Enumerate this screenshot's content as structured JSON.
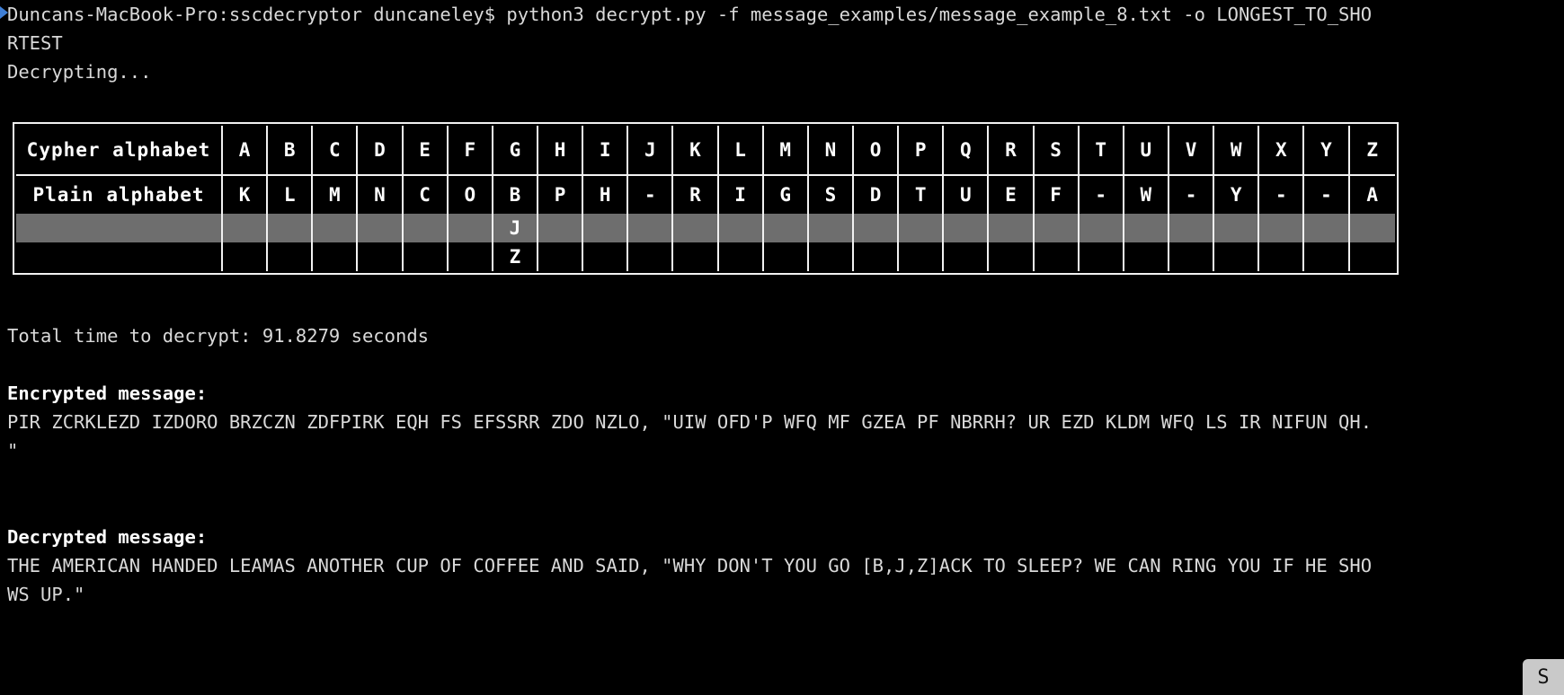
{
  "terminal": {
    "prompt_line_1": "Duncans-MacBook-Pro:sscdecryptor duncaneley$ python3 decrypt.py -f message_examples/message_example_8.txt -o LONGEST_TO_SHO",
    "prompt_line_2": "RTEST",
    "status_line": "Decrypting...",
    "total_time_line": "Total time to decrypt: 91.8279 seconds",
    "encrypted_heading": "Encrypted message:",
    "encrypted_line_1": "PIR ZCRKLEZD IZDORO BRZCZN ZDFPIRK EQH FS EFSSRR ZDO NZLO, \"UIW OFD'P WFQ MF GZEA PF NBRRH? UR EZD KLDM WFQ LS IR NIFUN QH.",
    "encrypted_line_2": "\"",
    "decrypted_heading": "Decrypted message:",
    "decrypted_line_1": "THE AMERICAN HANDED LEAMAS ANOTHER CUP OF COFFEE AND SAID, \"WHY DON'T YOU GO [B,J,Z]ACK TO SLEEP? WE CAN RING YOU IF HE SHO",
    "decrypted_line_2": "WS UP.\"",
    "badge_label": "S"
  },
  "table": {
    "row_labels": {
      "cypher": "Cypher alphabet",
      "plain": "Plain alphabet"
    },
    "cypher_alphabet": [
      "A",
      "B",
      "C",
      "D",
      "E",
      "F",
      "G",
      "H",
      "I",
      "J",
      "K",
      "L",
      "M",
      "N",
      "O",
      "P",
      "Q",
      "R",
      "S",
      "T",
      "U",
      "V",
      "W",
      "X",
      "Y",
      "Z"
    ],
    "plain_alphabet_row1": [
      "K",
      "L",
      "M",
      "N",
      "C",
      "O",
      "B",
      "P",
      "H",
      "-",
      "R",
      "I",
      "G",
      "S",
      "D",
      "T",
      "U",
      "E",
      "F",
      "-",
      "W",
      "-",
      "Y",
      "-",
      "-",
      "A"
    ],
    "plain_alphabet_row2": [
      "",
      "",
      "",
      "",
      "",
      "",
      "J",
      "",
      "",
      "",
      "",
      "",
      "",
      "",
      "",
      "",
      "",
      "",
      "",
      "",
      "",
      "",
      "",
      "",
      "",
      ""
    ],
    "plain_alphabet_row3": [
      "",
      "",
      "",
      "",
      "",
      "",
      "Z",
      "",
      "",
      "",
      "",
      "",
      "",
      "",
      "",
      "",
      "",
      "",
      "",
      "",
      "",
      "",
      "",
      "",
      "",
      ""
    ],
    "selection_color": "#6e6e6e",
    "border_color": "#f2f2f2"
  },
  "colors": {
    "background": "#000000",
    "text": "#d9d9d9",
    "bold_text": "#ffffff",
    "prompt_marker": "#3f7fd6"
  }
}
